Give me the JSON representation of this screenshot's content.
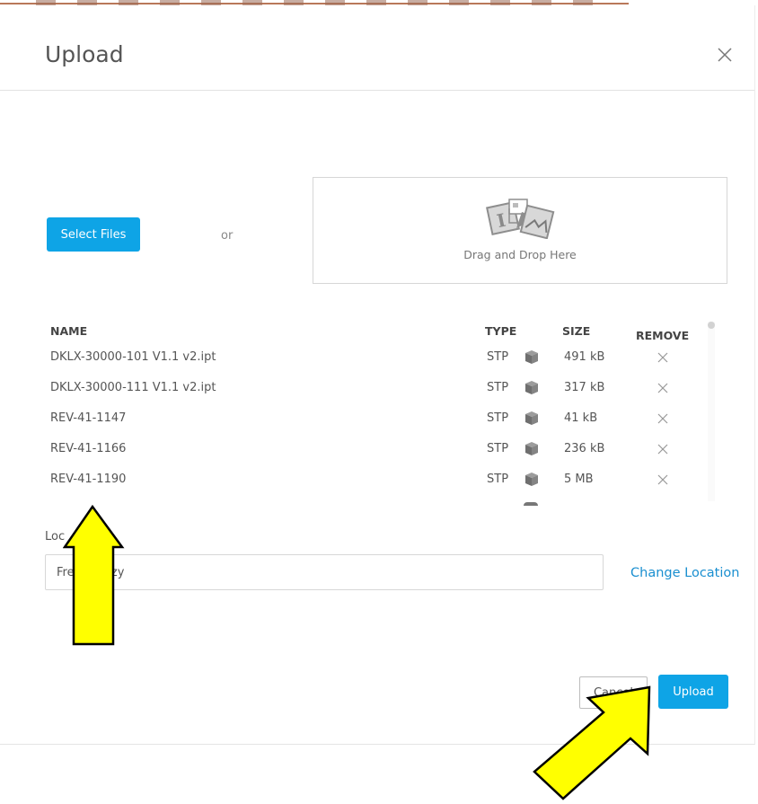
{
  "dialog": {
    "title": "Upload",
    "close_icon": "close-icon"
  },
  "upload_area": {
    "select_files_label": "Select Files",
    "or_text": "or",
    "drop_icon": "image-upload-icon",
    "drop_text": "Drag and Drop Here"
  },
  "table": {
    "headers": {
      "name": "NAME",
      "type": "TYPE",
      "size": "SIZE",
      "remove": "REMOVE"
    },
    "type_icon": "cube-icon",
    "remove_icon": "close-icon",
    "rows": [
      {
        "name": "DKLX-30000-101 V1.1 v2.ipt",
        "type": "STP",
        "size": "491 kB"
      },
      {
        "name": "DKLX-30000-111 V1.1 v2.ipt",
        "type": "STP",
        "size": "317 kB"
      },
      {
        "name": "REV-41-1147",
        "type": "STP",
        "size": "41 kB"
      },
      {
        "name": "REV-41-1166",
        "type": "STP",
        "size": "236 kB"
      },
      {
        "name": "REV-41-1190",
        "type": "STP",
        "size": "5 MB"
      }
    ]
  },
  "location": {
    "label": "Loc",
    "value": "Fre        nzy",
    "change_label": "Change Location"
  },
  "footer": {
    "cancel_label": "Cancel",
    "upload_label": "Upload"
  },
  "annotations": {
    "arrow_color": "#ffff00",
    "arrow_outline": "#000000"
  }
}
